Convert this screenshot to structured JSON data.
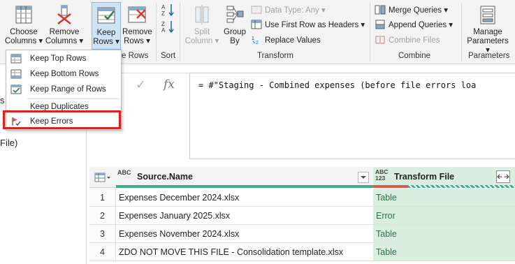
{
  "ribbon": {
    "choose_columns": [
      "Choose",
      "Columns ▾"
    ],
    "remove_columns": [
      "Remove",
      "Columns ▾"
    ],
    "keep_rows": [
      "Keep",
      "Rows ▾"
    ],
    "remove_rows": [
      "Remove",
      "Rows ▾"
    ],
    "remove_rows_group_label": "e Rows",
    "sort_group_label": "Sort",
    "split_column": [
      "Split",
      "Column ▾"
    ],
    "group_by": [
      "Group",
      "By"
    ],
    "data_type": "Data Type: Any ▾",
    "use_first_row": "Use First Row as Headers ▾",
    "replace_values": "Replace Values",
    "transform_group_label": "Transform",
    "merge_queries": "Merge Queries ▾",
    "append_queries": "Append Queries ▾",
    "combine_files": "Combine Files",
    "combine_group_label": "Combine",
    "manage_parameters": [
      "Manage",
      "Parameters ▾"
    ],
    "parameters_group_label": "Parameters"
  },
  "keep_rows_menu": {
    "items": [
      {
        "label": "Keep Top Rows",
        "icon": "keep-top-rows-icon"
      },
      {
        "label": "Keep Bottom Rows",
        "icon": "keep-bottom-rows-icon"
      },
      {
        "label": "Keep Range of Rows",
        "icon": "keep-range-icon"
      },
      {
        "label": "Keep Duplicates",
        "icon": "none"
      },
      {
        "label": "Keep Errors",
        "icon": "keep-errors-icon"
      }
    ],
    "highlighted": "Keep Errors"
  },
  "left_pane": {
    "frag_s": "s",
    "frag_file": "File)"
  },
  "formula_bar": {
    "cancel_glyph": "✓",
    "fx_glyph": "fx",
    "formula": "= #\"Staging - Combined expenses (before file errors loa"
  },
  "table": {
    "columns": [
      {
        "type": "ABC",
        "name": "Source.Name"
      },
      {
        "type": "ABC 123",
        "name": "Transform File"
      }
    ],
    "rows": [
      {
        "num": "1",
        "source": "Expenses December 2024.xlsx",
        "transform": "Table"
      },
      {
        "num": "2",
        "source": "Expenses January 2025.xlsx",
        "transform": "Error"
      },
      {
        "num": "3",
        "source": "Expenses November 2024.xlsx",
        "transform": "Table"
      },
      {
        "num": "4",
        "source": "ZDO NOT MOVE THIS FILE - Consolidation template.xlsx",
        "transform": "Table"
      }
    ]
  },
  "colors": {
    "accent_green": "#3aaf8f",
    "error_red": "#e05a4e",
    "highlight_red": "#e01f1f",
    "pressed_blue": "#cfe3f7"
  }
}
